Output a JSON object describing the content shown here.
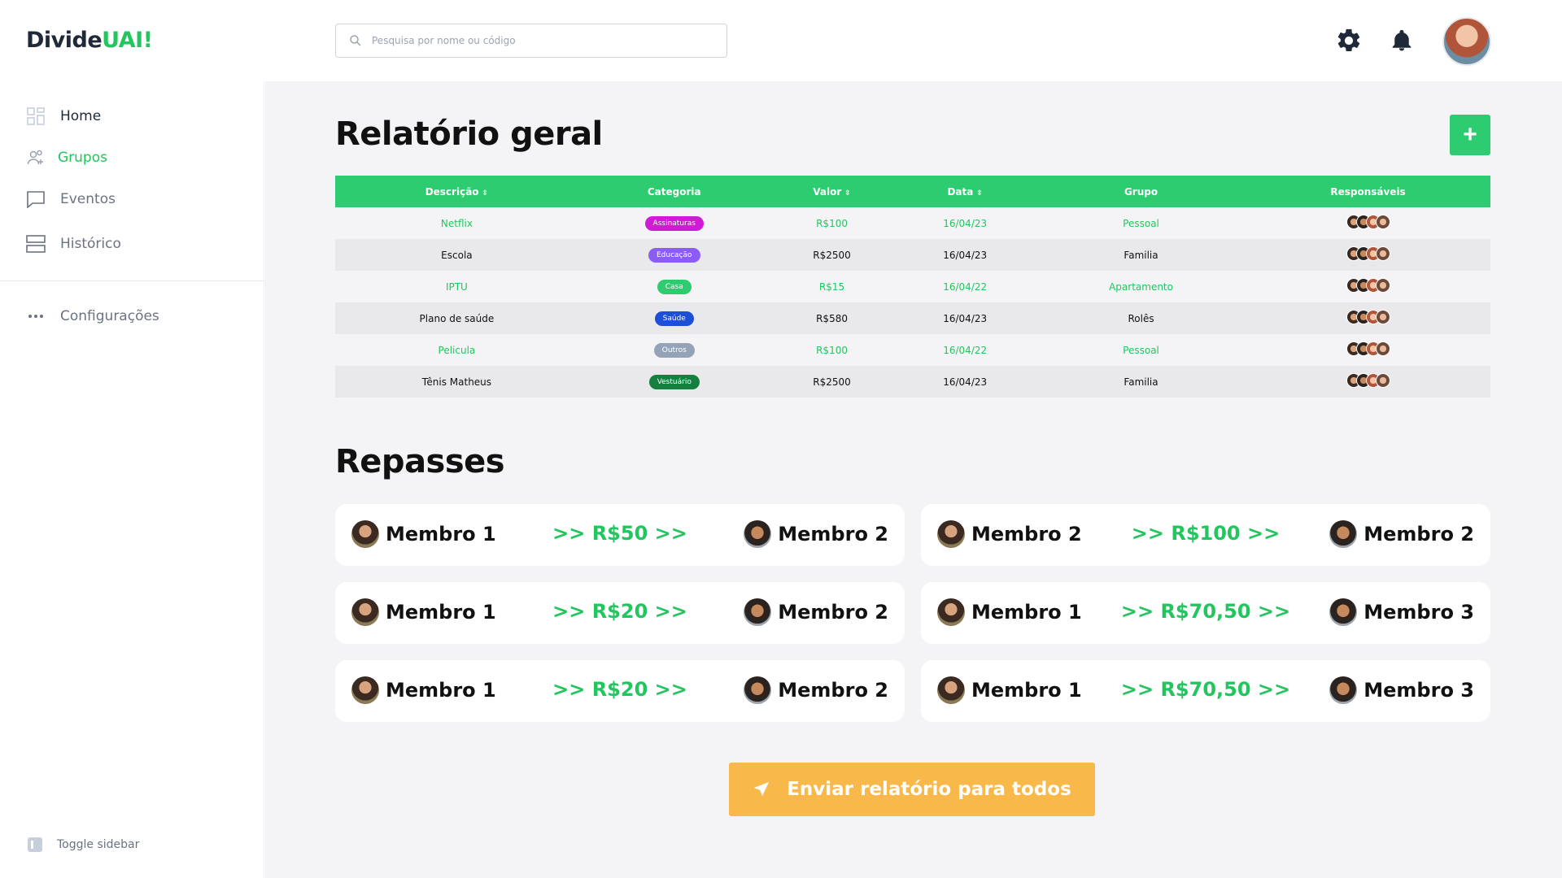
{
  "app": {
    "logo_part1": "Divide",
    "logo_part2": "UAI!"
  },
  "search": {
    "placeholder": "Pesquisa por nome ou código"
  },
  "sidebar": {
    "items": [
      {
        "label": "Home",
        "icon": "grid-icon"
      },
      {
        "label": "Grupos",
        "icon": "users-icon"
      },
      {
        "label": "Eventos",
        "icon": "chat-icon"
      },
      {
        "label": "Histórico",
        "icon": "layers-icon"
      }
    ],
    "settings_label": "Configurações",
    "toggle_label": "Toggle sidebar"
  },
  "report": {
    "title": "Relatório geral",
    "add_label": "+",
    "columns": [
      "Descrição",
      "Categoria",
      "Valor",
      "Data",
      "Grupo",
      "Responsáveis"
    ],
    "rows": [
      {
        "descricao": "Netflix",
        "categoria": "Assinaturas",
        "cat_color": "#d01ad6",
        "valor": "R$100",
        "data": "16/04/23",
        "grupo": "Pessoal"
      },
      {
        "descricao": "Escola",
        "categoria": "Educação",
        "cat_color": "#8b5cf6",
        "valor": "R$2500",
        "data": "16/04/23",
        "grupo": "Familia"
      },
      {
        "descricao": "IPTU",
        "categoria": "Casa",
        "cat_color": "#2ecc71",
        "valor": "R$15",
        "data": "16/04/22",
        "grupo": "Apartamento"
      },
      {
        "descricao": "Plano de saúde",
        "categoria": "Saúde",
        "cat_color": "#1d4ed8",
        "valor": "R$580",
        "data": "16/04/23",
        "grupo": "Rolês"
      },
      {
        "descricao": "Pelicula",
        "categoria": "Outros",
        "cat_color": "#94a3b8",
        "valor": "R$100",
        "data": "16/04/22",
        "grupo": "Pessoal"
      },
      {
        "descricao": "Tênis Matheus",
        "categoria": "Vestuário",
        "cat_color": "#15803d",
        "valor": "R$2500",
        "data": "16/04/23",
        "grupo": "Familia"
      }
    ]
  },
  "repasses": {
    "title": "Repasses",
    "items": [
      {
        "from": "Membro 1",
        "amount": ">> R$50 >>",
        "to": "Membro 2"
      },
      {
        "from": "Membro 2",
        "amount": ">> R$100 >>",
        "to": "Membro 2"
      },
      {
        "from": "Membro 1",
        "amount": ">> R$20 >>",
        "to": "Membro 2"
      },
      {
        "from": "Membro 1",
        "amount": ">> R$70,50 >>",
        "to": "Membro 3"
      },
      {
        "from": "Membro 1",
        "amount": ">> R$20 >>",
        "to": "Membro 2"
      },
      {
        "from": "Membro 1",
        "amount": ">> R$70,50 >>",
        "to": "Membro 3"
      }
    ]
  },
  "send_button": {
    "label": "Enviar relatório para todos"
  },
  "colors": {
    "accent": "#2ecc71",
    "send": "#f9b84a"
  }
}
